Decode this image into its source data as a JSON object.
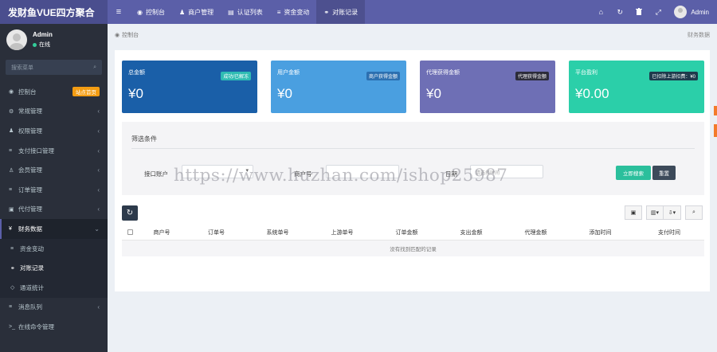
{
  "app": {
    "logo": "发财鱼VUE四方聚合"
  },
  "topnav": {
    "items": [
      {
        "icon": "dashboard-icon",
        "glyph": "◉",
        "label": "控制台"
      },
      {
        "icon": "user-icon",
        "glyph": "♟",
        "label": "商户管理"
      },
      {
        "icon": "id-card-icon",
        "glyph": "▤",
        "label": "认证列表"
      },
      {
        "icon": "list-icon",
        "glyph": "≡",
        "label": "资金变动"
      },
      {
        "icon": "handshake-icon",
        "glyph": "⚭",
        "label": "对账记录"
      }
    ],
    "active_index": 4,
    "right_icons": [
      {
        "name": "home-icon",
        "glyph": "⌂"
      },
      {
        "name": "refresh-icon",
        "glyph": "↻"
      },
      {
        "name": "trash-icon",
        "glyph": "🗑"
      },
      {
        "name": "fullscreen-icon",
        "glyph": "⤢"
      }
    ],
    "user_name": "Admin"
  },
  "sidebar": {
    "user": {
      "name": "Admin",
      "status": "在线"
    },
    "search_placeholder": "搜索菜单",
    "items": [
      {
        "icon": "dashboard-icon",
        "glyph": "◉",
        "label": "控制台",
        "badge": "站点首页",
        "chevron": false
      },
      {
        "icon": "cogs-icon",
        "glyph": "⚙",
        "label": "常规管理",
        "chevron": true
      },
      {
        "icon": "group-icon",
        "glyph": "♟",
        "label": "权限管理",
        "chevron": true
      },
      {
        "icon": "list-icon",
        "glyph": "≡",
        "label": "支付接口管理",
        "chevron": true
      },
      {
        "icon": "user-icon",
        "glyph": "♙",
        "label": "会员管理",
        "chevron": true
      },
      {
        "icon": "list-icon",
        "glyph": "≡",
        "label": "订单管理",
        "chevron": true
      },
      {
        "icon": "money-icon",
        "glyph": "▣",
        "label": "代付管理",
        "chevron": true
      },
      {
        "icon": "yen-icon",
        "glyph": "¥",
        "label": "财务数据",
        "chevron": true,
        "open": true
      },
      {
        "icon": "list-icon",
        "glyph": "≡",
        "label": "资金变动",
        "sub": true
      },
      {
        "icon": "handshake-icon",
        "glyph": "⚭",
        "label": "对账记录",
        "sub": true,
        "active": true
      },
      {
        "icon": "diamond-icon",
        "glyph": "◇",
        "label": "通道统计",
        "sub": true
      },
      {
        "icon": "list-icon",
        "glyph": "≡",
        "label": "消息队列",
        "chevron": true
      },
      {
        "icon": "terminal-icon",
        "glyph": ">_",
        "label": "在线命令管理",
        "chevron": false
      }
    ]
  },
  "breadcrumb": {
    "home": "控制台",
    "right": "财务数据"
  },
  "cards": [
    {
      "title": "总金额",
      "tag": "成功/已解冻",
      "value": "¥0"
    },
    {
      "title": "用户金额",
      "tag": "商户获得金额",
      "value": "¥0"
    },
    {
      "title": "代理获得金额",
      "tag": "代理获得金额",
      "value": "¥0"
    },
    {
      "title": "平台盈利",
      "tag": "已扣除上游扣费：¥0",
      "value": "¥0.00"
    }
  ],
  "filter": {
    "title": "筛选条件",
    "channel_label": "接口账户",
    "merchant_label": "商户号",
    "date_label": "日期",
    "date_placeholder": "请选择时间",
    "search_button": "立即搜索",
    "reset_button": "重置"
  },
  "table": {
    "headers": [
      "商户号",
      "订单号",
      "系统单号",
      "上游单号",
      "订单金额",
      "支出金额",
      "代理金额",
      "添加时间",
      "支付时间"
    ],
    "empty_text": "没有找到匹配的记录"
  },
  "watermark": "https://www.huzhan.com/ishop25987",
  "colors": {
    "topbar": "#5b5fa8",
    "sidebar": "#2a2f3a",
    "card1": "#1a5fa8",
    "card2": "#4a9fe0",
    "card3": "#6e6fb5",
    "card4": "#2bcfa9",
    "search_button": "#2bbf9c"
  }
}
